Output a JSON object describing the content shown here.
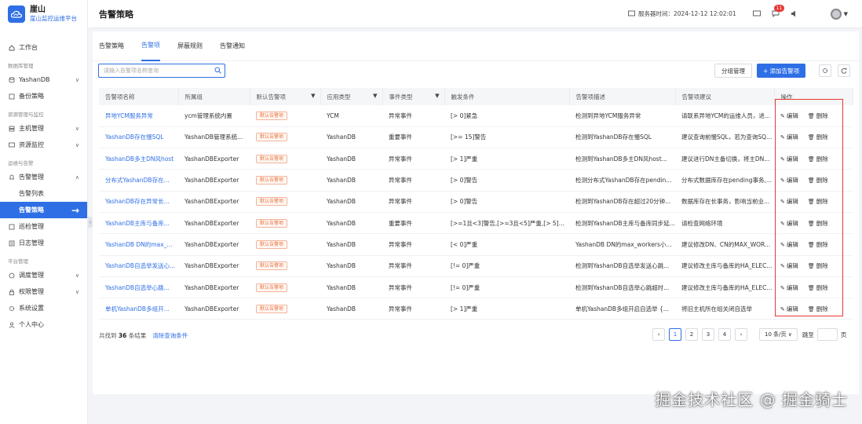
{
  "app": {
    "name": "崖山",
    "subtitle": "崖山监控运维平台"
  },
  "header": {
    "title": "告警策略",
    "server_time": "服务器时间：2024-12-12 12:02:01",
    "badge_count": "11"
  },
  "sidebar": {
    "workbench": "工作台",
    "sections": {
      "db": "数据库管理",
      "resource": "资源管理与监控",
      "ops": "运维与告警",
      "platform": "平台管理"
    },
    "items": {
      "yashandb": "YashanDB",
      "backup": "备份策略",
      "host": "主机管理",
      "resmon": "资源监控",
      "alarm": "告警管理",
      "alarm_list": "告警列表",
      "alarm_policy": "告警策略",
      "inspect": "巡检管理",
      "log": "日志管理",
      "schedule": "调度管理",
      "perm": "权限管理",
      "settings": "系统设置",
      "personal": "个人中心"
    }
  },
  "tabs": [
    "告警策略",
    "告警项",
    "屏蔽规则",
    "告警通知"
  ],
  "toolbar": {
    "search_placeholder": "请输入告警项名称查询",
    "group_btn": "分组管理",
    "add_btn": "+ 添加告警项"
  },
  "table": {
    "headers": [
      "告警项名称",
      "所属组",
      "默认告警项",
      "应用类型",
      "事件类型",
      "触发条件",
      "告警项描述",
      "告警项建议",
      "操作"
    ],
    "default_tag": "默认告警项",
    "edit": "编辑",
    "delete": "删除",
    "rows": [
      [
        "异地YCM服务异常",
        "ycm管理系统内置",
        "YCM",
        "异常事件",
        "[> 0]紧急",
        "检测到异地YCM服务异常",
        "请联系异地YCM的运维人员，进..."
      ],
      [
        "YashanDB存在慢SQL",
        "YashanDB管理系统...",
        "YashanDB",
        "重要事件",
        "[>= 15]警告",
        "检测到YashanDB存在慢SQL",
        "建议查询前慢SQL，若为查询SQL..."
      ],
      [
        "YashanDB多主DN风host",
        "YashanDBExporter",
        "YashanDB",
        "异常事件",
        "[> 1]严重",
        "检测到YashanDB多主DN风host...",
        "建议进行DN主备切换，将主DN..."
      ],
      [
        "分布式YashanDB存在...",
        "YashanDBExporter",
        "YashanDB",
        "异常事件",
        "[> 0]警告",
        "检测分布式YashanDB存在pendin...",
        "分布式数据库存在pending事务,..."
      ],
      [
        "YashanDB存在异常长...",
        "YashanDBExporter",
        "YashanDB",
        "异常事件",
        "[> 0]警告",
        "检测到YashanDB存在超过20分钟...",
        "数据库存在长事务，影响当前业..."
      ],
      [
        "YashanDB主库与备库...",
        "YashanDBExporter",
        "YashanDB",
        "重要事件",
        "[>=1且<3]警告,[>=3且<5]严重,[> 5]紧急",
        "检测到YashanDB主库与备库同步延...",
        "请检查网络环境"
      ],
      [
        "YashanDB DN的max_...",
        "YashanDBExporter",
        "YashanDB",
        "异常事件",
        "[< 0]严重",
        "YashanDB DN的max_workers小...",
        "建议修改DN、CN的MAX_WOR..."
      ],
      [
        "YashanDB自选举发送心...",
        "YashanDBExporter",
        "YashanDB",
        "异常事件",
        "[!= 0]严重",
        "检测到YashanDB自选举发送心跳...",
        "建议修改主库与备库的HA_ELEC..."
      ],
      [
        "YashanDB自选举心跳...",
        "YashanDBExporter",
        "YashanDB",
        "异常事件",
        "[!= 0]严重",
        "检测到YashanDB自选举心跳超时...",
        "建议修改主库与备库的HA_ELEC..."
      ],
      [
        "单机YashanDB多组开...",
        "YashanDBExporter",
        "YashanDB",
        "异常事件",
        "[> 1]严重",
        "单机YashanDB多组开启自选举 {...",
        "将旧主机所在组关闭自选举"
      ]
    ]
  },
  "footer": {
    "total_prefix": "共找到",
    "total_count": "36",
    "total_suffix": "条结果",
    "clear": "清除查询条件",
    "pages": [
      "1",
      "2",
      "3",
      "4"
    ],
    "page_size": "10 条/页",
    "jump": "跳至",
    "page_unit": "页"
  },
  "watermark": "掘金技术社区 @ 掘金骑士",
  "colors": {
    "primary": "#2f6fe5",
    "highlight_box": "#e53935",
    "tag": "#e8733d"
  }
}
